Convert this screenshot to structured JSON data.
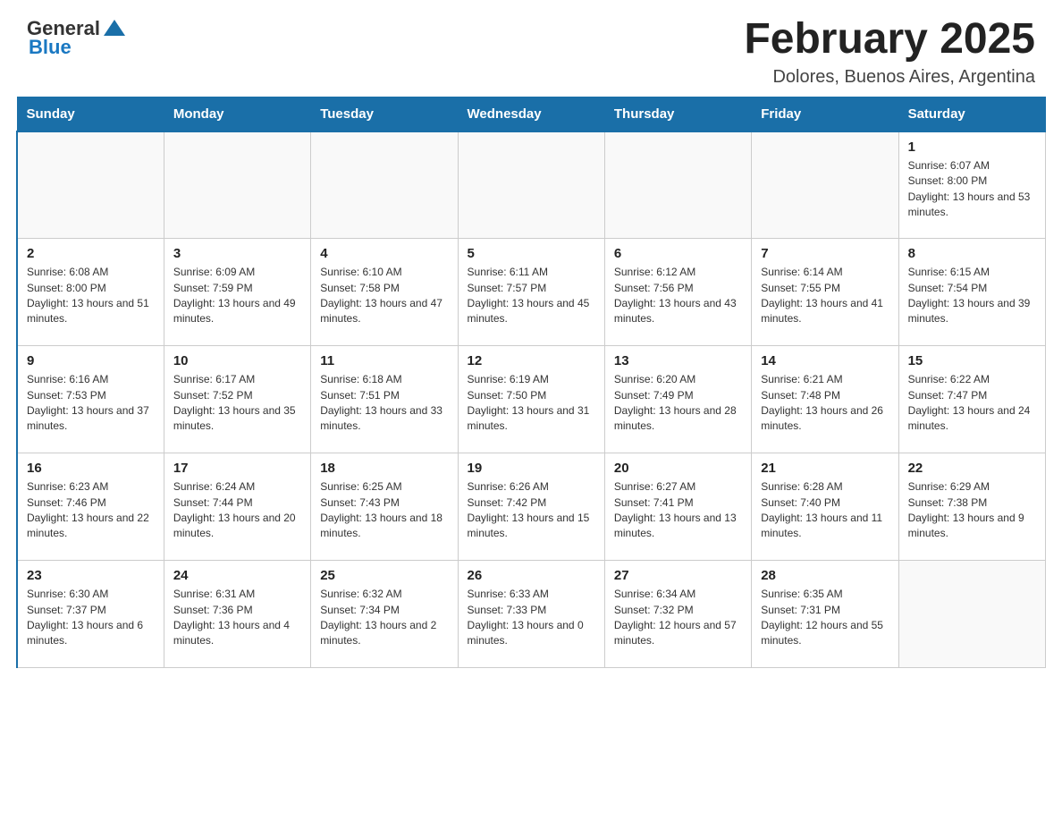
{
  "header": {
    "logo_general": "General",
    "logo_blue": "Blue",
    "month_year": "February 2025",
    "location": "Dolores, Buenos Aires, Argentina"
  },
  "days_of_week": [
    "Sunday",
    "Monday",
    "Tuesday",
    "Wednesday",
    "Thursday",
    "Friday",
    "Saturday"
  ],
  "weeks": [
    [
      {
        "day": "",
        "info": ""
      },
      {
        "day": "",
        "info": ""
      },
      {
        "day": "",
        "info": ""
      },
      {
        "day": "",
        "info": ""
      },
      {
        "day": "",
        "info": ""
      },
      {
        "day": "",
        "info": ""
      },
      {
        "day": "1",
        "info": "Sunrise: 6:07 AM\nSunset: 8:00 PM\nDaylight: 13 hours and 53 minutes."
      }
    ],
    [
      {
        "day": "2",
        "info": "Sunrise: 6:08 AM\nSunset: 8:00 PM\nDaylight: 13 hours and 51 minutes."
      },
      {
        "day": "3",
        "info": "Sunrise: 6:09 AM\nSunset: 7:59 PM\nDaylight: 13 hours and 49 minutes."
      },
      {
        "day": "4",
        "info": "Sunrise: 6:10 AM\nSunset: 7:58 PM\nDaylight: 13 hours and 47 minutes."
      },
      {
        "day": "5",
        "info": "Sunrise: 6:11 AM\nSunset: 7:57 PM\nDaylight: 13 hours and 45 minutes."
      },
      {
        "day": "6",
        "info": "Sunrise: 6:12 AM\nSunset: 7:56 PM\nDaylight: 13 hours and 43 minutes."
      },
      {
        "day": "7",
        "info": "Sunrise: 6:14 AM\nSunset: 7:55 PM\nDaylight: 13 hours and 41 minutes."
      },
      {
        "day": "8",
        "info": "Sunrise: 6:15 AM\nSunset: 7:54 PM\nDaylight: 13 hours and 39 minutes."
      }
    ],
    [
      {
        "day": "9",
        "info": "Sunrise: 6:16 AM\nSunset: 7:53 PM\nDaylight: 13 hours and 37 minutes."
      },
      {
        "day": "10",
        "info": "Sunrise: 6:17 AM\nSunset: 7:52 PM\nDaylight: 13 hours and 35 minutes."
      },
      {
        "day": "11",
        "info": "Sunrise: 6:18 AM\nSunset: 7:51 PM\nDaylight: 13 hours and 33 minutes."
      },
      {
        "day": "12",
        "info": "Sunrise: 6:19 AM\nSunset: 7:50 PM\nDaylight: 13 hours and 31 minutes."
      },
      {
        "day": "13",
        "info": "Sunrise: 6:20 AM\nSunset: 7:49 PM\nDaylight: 13 hours and 28 minutes."
      },
      {
        "day": "14",
        "info": "Sunrise: 6:21 AM\nSunset: 7:48 PM\nDaylight: 13 hours and 26 minutes."
      },
      {
        "day": "15",
        "info": "Sunrise: 6:22 AM\nSunset: 7:47 PM\nDaylight: 13 hours and 24 minutes."
      }
    ],
    [
      {
        "day": "16",
        "info": "Sunrise: 6:23 AM\nSunset: 7:46 PM\nDaylight: 13 hours and 22 minutes."
      },
      {
        "day": "17",
        "info": "Sunrise: 6:24 AM\nSunset: 7:44 PM\nDaylight: 13 hours and 20 minutes."
      },
      {
        "day": "18",
        "info": "Sunrise: 6:25 AM\nSunset: 7:43 PM\nDaylight: 13 hours and 18 minutes."
      },
      {
        "day": "19",
        "info": "Sunrise: 6:26 AM\nSunset: 7:42 PM\nDaylight: 13 hours and 15 minutes."
      },
      {
        "day": "20",
        "info": "Sunrise: 6:27 AM\nSunset: 7:41 PM\nDaylight: 13 hours and 13 minutes."
      },
      {
        "day": "21",
        "info": "Sunrise: 6:28 AM\nSunset: 7:40 PM\nDaylight: 13 hours and 11 minutes."
      },
      {
        "day": "22",
        "info": "Sunrise: 6:29 AM\nSunset: 7:38 PM\nDaylight: 13 hours and 9 minutes."
      }
    ],
    [
      {
        "day": "23",
        "info": "Sunrise: 6:30 AM\nSunset: 7:37 PM\nDaylight: 13 hours and 6 minutes."
      },
      {
        "day": "24",
        "info": "Sunrise: 6:31 AM\nSunset: 7:36 PM\nDaylight: 13 hours and 4 minutes."
      },
      {
        "day": "25",
        "info": "Sunrise: 6:32 AM\nSunset: 7:34 PM\nDaylight: 13 hours and 2 minutes."
      },
      {
        "day": "26",
        "info": "Sunrise: 6:33 AM\nSunset: 7:33 PM\nDaylight: 13 hours and 0 minutes."
      },
      {
        "day": "27",
        "info": "Sunrise: 6:34 AM\nSunset: 7:32 PM\nDaylight: 12 hours and 57 minutes."
      },
      {
        "day": "28",
        "info": "Sunrise: 6:35 AM\nSunset: 7:31 PM\nDaylight: 12 hours and 55 minutes."
      },
      {
        "day": "",
        "info": ""
      }
    ]
  ]
}
